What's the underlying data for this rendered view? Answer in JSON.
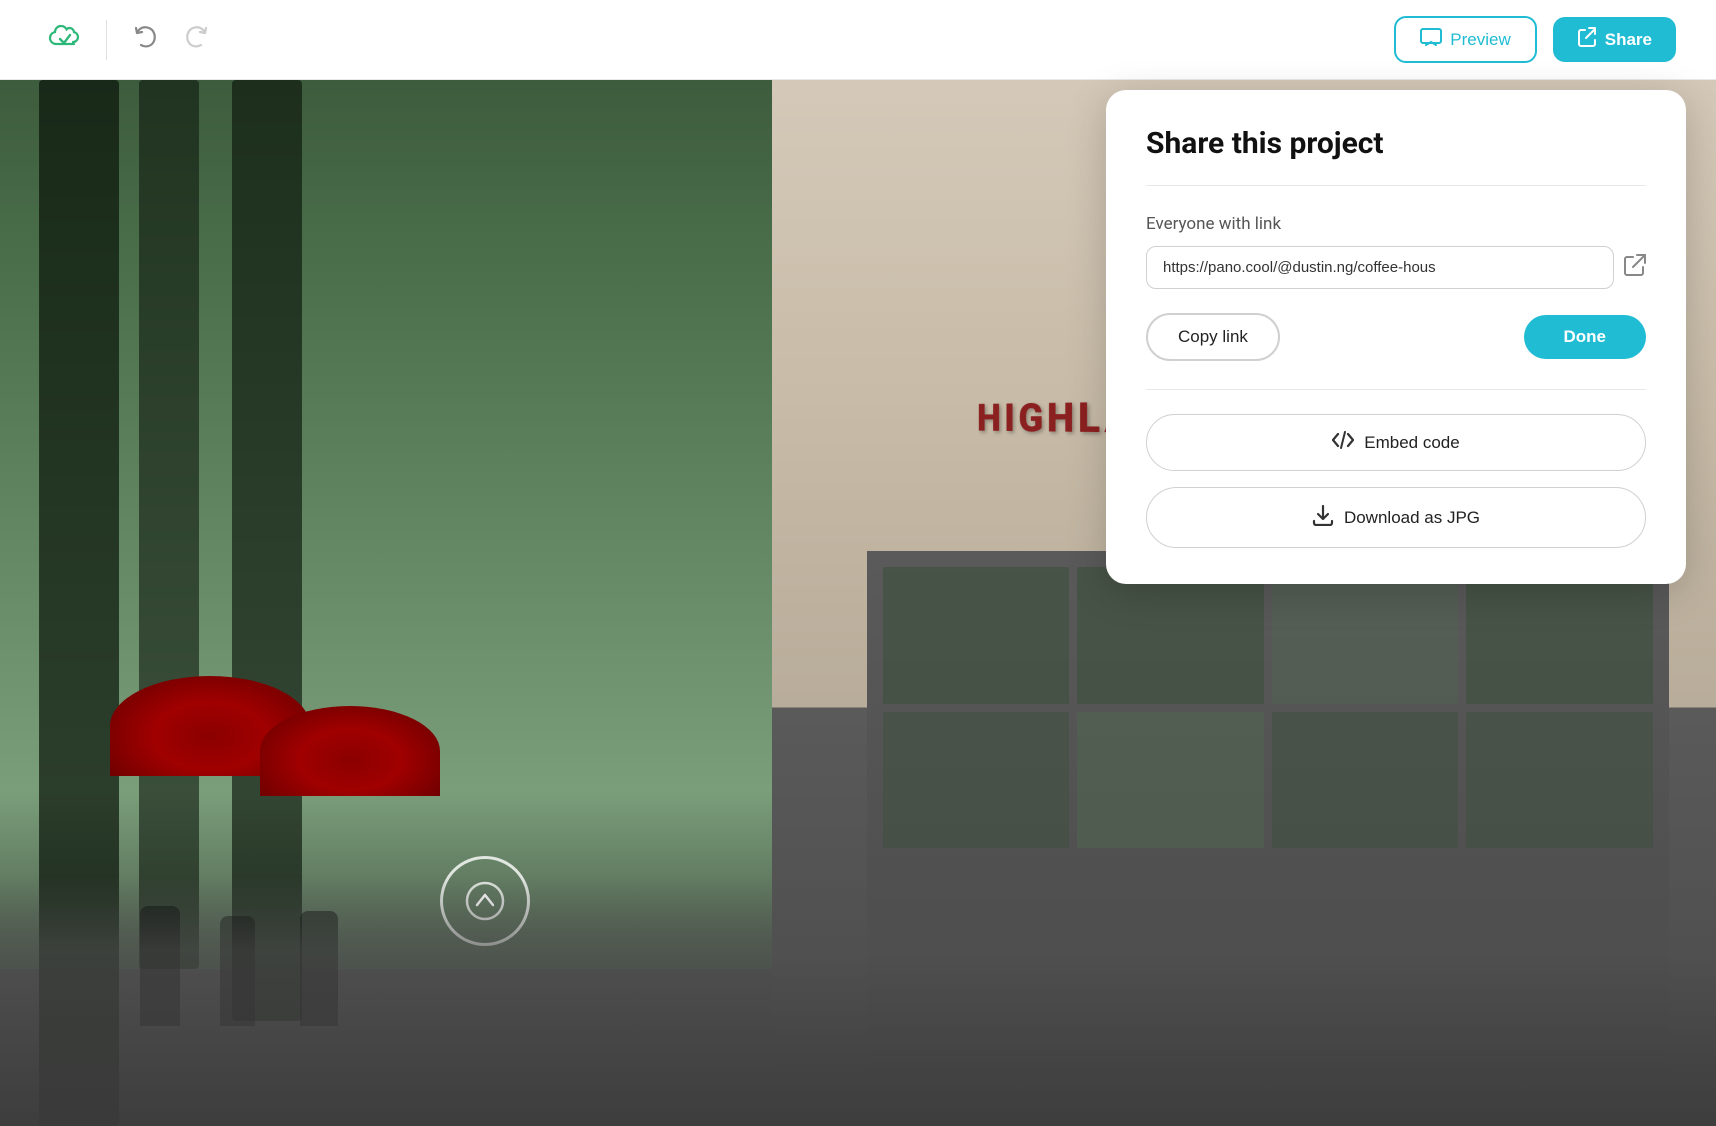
{
  "toolbar": {
    "preview_label": "Preview",
    "share_label": "Share"
  },
  "share_panel": {
    "title": "Share this project",
    "everyone_label": "Everyone with link",
    "link_url": "https://pano.cool/@dustin.ng/coffee-hous",
    "copy_link_label": "Copy link",
    "done_label": "Done",
    "embed_code_label": "Embed code",
    "download_jpg_label": "Download as JPG"
  },
  "nav_circle": {
    "icon": "⌃"
  }
}
